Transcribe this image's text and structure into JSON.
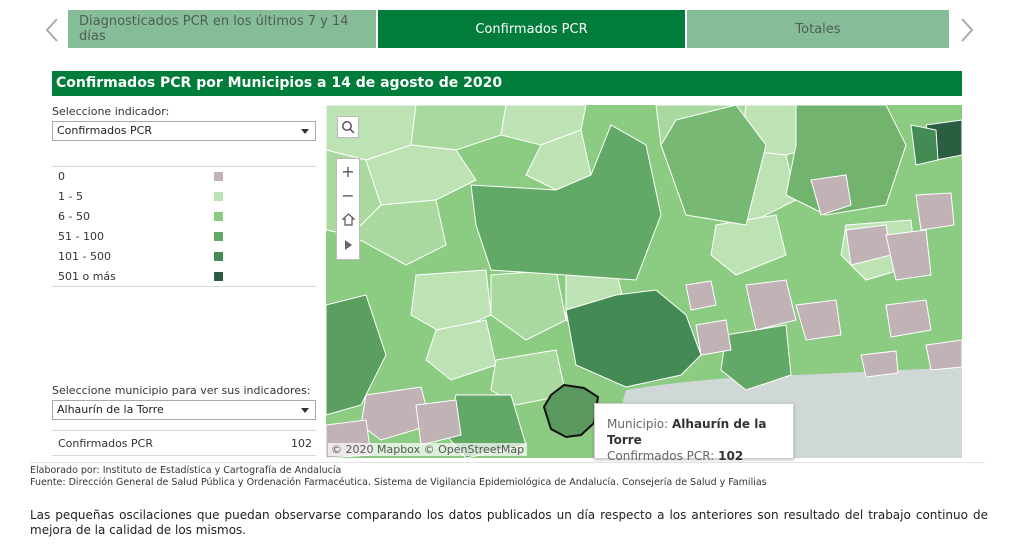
{
  "tabs": [
    {
      "label": "Diagnosticados PCR en los últimos 7 y 14 días",
      "active": false
    },
    {
      "label": "Confirmados PCR",
      "active": true
    },
    {
      "label": "Totales",
      "active": false
    }
  ],
  "nav": {
    "prev_icon": "chevron-left-icon",
    "next_icon": "chevron-right-icon"
  },
  "title": "Confirmados PCR por Municipios a 14 de agosto de 2020",
  "indicator": {
    "label": "Seleccione indicador:",
    "value": "Confirmados PCR"
  },
  "legend": [
    {
      "label": "0",
      "color": "#c1b2b5"
    },
    {
      "label": "1 - 5",
      "color": "#bde3b4"
    },
    {
      "label": "6 - 50",
      "color": "#8ccb82"
    },
    {
      "label": "51 - 100",
      "color": "#62a866"
    },
    {
      "label": "101 - 500",
      "color": "#448a55"
    },
    {
      "label": "501 o más",
      "color": "#2b5e40"
    }
  ],
  "municipio": {
    "label": "Seleccione municipio para ver sus indicadores:",
    "value": "Alhaurín de la Torre"
  },
  "result": {
    "label": "Confirmados PCR",
    "value": "102"
  },
  "map": {
    "attribution": "© 2020 Mapbox © OpenStreetMap",
    "controls": [
      "search-icon",
      "zoom-in-icon",
      "zoom-out-icon",
      "home-icon",
      "play-icon"
    ]
  },
  "tooltip": {
    "municipio_label": "Municipio:",
    "municipio_value": "Alhaurín de la Torre",
    "indicator_label": "Confirmados PCR:",
    "indicator_value": "102"
  },
  "footer": {
    "elaborado": "Elaborado por: Instituto de Estadística y Cartografía de Andalucía",
    "fuente": "Fuente: Dirección General de Salud Pública y Ordenación Farmacéutica. Sistema de Vigilancia Epidemiológica de Andalucía. Consejería de Salud y Familias"
  },
  "note": "Las pequeñas oscilaciones que puedan observarse comparando los datos publicados un día respecto a los anteriores son resultado del trabajo continuo de mejora de la calidad de los mismos."
}
